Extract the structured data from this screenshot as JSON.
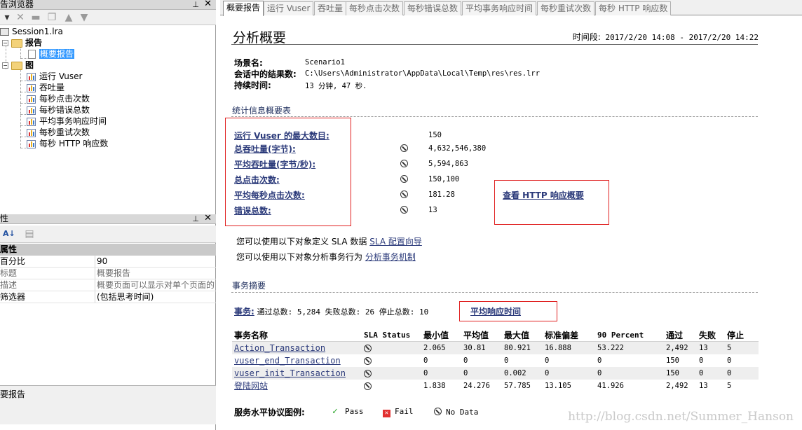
{
  "browser_pane": {
    "title": "告浏览器",
    "pin": "📌",
    "close": "✕"
  },
  "tree": {
    "session": "Session1.lra",
    "reports_folder": "报告",
    "summary_report": "概要报告",
    "graphs_folder": "图",
    "graphs": [
      "运行 Vuser",
      "吞吐量",
      "每秒点击次数",
      "每秒错误总数",
      "平均事务响应时间",
      "每秒重试次数",
      "每秒 HTTP 响应数"
    ]
  },
  "properties_pane": {
    "title": "性",
    "category": "属性",
    "rows": [
      {
        "key": "百分比",
        "value": "90",
        "dim": false
      },
      {
        "key": "标题",
        "value": "概要报告",
        "dim": true
      },
      {
        "key": "描述",
        "value": "概要页面可以显示对单个页面的",
        "dim": true
      },
      {
        "key": "筛选器",
        "value": "(包括思考时间)",
        "dim": false
      }
    ],
    "description_title": "要报告"
  },
  "tabs": [
    "概要报告",
    "运行 Vuser",
    "吞吐量",
    "每秒点击次数",
    "每秒错误总数",
    "平均事务响应时间",
    "每秒重试次数",
    "每秒 HTTP 响应数"
  ],
  "report": {
    "title": "分析概要",
    "period_label": "时间段:",
    "period_value": "2017/2/20 14:08 - 2017/2/20 14:22",
    "scenario_label": "场景名:",
    "scenario_value": "Scenario1",
    "results_label": "会话中的结果数:",
    "results_value": "C:\\Users\\Administrator\\AppData\\Local\\Temp\\res\\res.lrr",
    "duration_label": "持续时间:",
    "duration_value": "13 分钟, 47 秒.",
    "stats_section": "统计信息概要表",
    "stats": [
      {
        "label": "运行 Vuser 的最大数目:",
        "value": "150",
        "icon": false
      },
      {
        "label": "总吞吐量(字节):",
        "value": "4,632,546,380",
        "icon": true
      },
      {
        "label": "平均吞吐量(字节/秒):",
        "value": "5,594,863",
        "icon": true
      },
      {
        "label": "总点击次数:",
        "value": "150,100",
        "icon": true
      },
      {
        "label": "平均每秒点击次数:",
        "value": "181.28",
        "icon": true
      },
      {
        "label": "错误总数:",
        "value": "13",
        "icon": true
      }
    ],
    "http_link": "查看 HTTP 响应概要",
    "sla_text": "您可以使用以下对象定义 SLA 数据",
    "sla_link": "SLA 配置向导",
    "analyze_text": "您可以使用以下对象分析事务行为",
    "analyze_link": "分析事务机制",
    "tx_section": "事务摘要",
    "tx_label": "事务:",
    "tx_summary": "通过总数: 5,284 失败总数: 26 停止总数: 10",
    "avg_resp_link": "平均响应时间",
    "table": {
      "headers": [
        "事务名称",
        "SLA Status",
        "最小值",
        "平均值",
        "最大值",
        "标准偏差",
        "90 Percent",
        "通过",
        "失败",
        "停止"
      ],
      "rows": [
        [
          "Action_Transaction",
          "",
          "2.065",
          "30.81",
          "80.921",
          "16.888",
          "53.222",
          "2,492",
          "13",
          "5"
        ],
        [
          "vuser_end_Transaction",
          "",
          "0",
          "0",
          "0",
          "0",
          "0",
          "150",
          "0",
          "0"
        ],
        [
          "vuser_init_Transaction",
          "",
          "0",
          "0",
          "0.002",
          "0",
          "0",
          "150",
          "0",
          "0"
        ],
        [
          "登陆网站",
          "",
          "1.838",
          "24.276",
          "57.785",
          "13.105",
          "41.926",
          "2,492",
          "13",
          "5"
        ]
      ]
    },
    "legend_label": "服务水平协议图例:",
    "legend_pass": "Pass",
    "legend_fail": "Fail",
    "legend_nodata": "No Data",
    "watermark": "http://blog.csdn.net/Summer_Hanson"
  }
}
